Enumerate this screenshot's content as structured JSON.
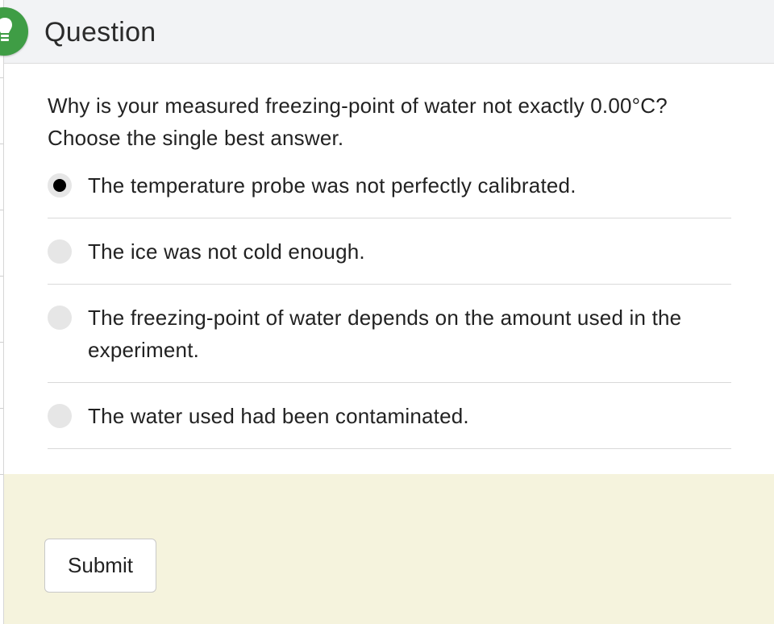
{
  "header": {
    "title": "Question",
    "icon": "lightbulb-icon",
    "badge_color": "#3f9d45"
  },
  "question": {
    "text": "Why is your measured freezing-point of water not exactly 0.00°C? Choose the single best answer."
  },
  "options": [
    {
      "label": "The temperature probe was not perfectly calibrated.",
      "selected": true
    },
    {
      "label": "The ice was not cold enough.",
      "selected": false
    },
    {
      "label": "The freezing-point of water depends on the amount used in the experiment.",
      "selected": false
    },
    {
      "label": "The water used had been contaminated.",
      "selected": false
    }
  ],
  "footer": {
    "submit_label": "Submit",
    "background_color": "#f5f3dd"
  }
}
